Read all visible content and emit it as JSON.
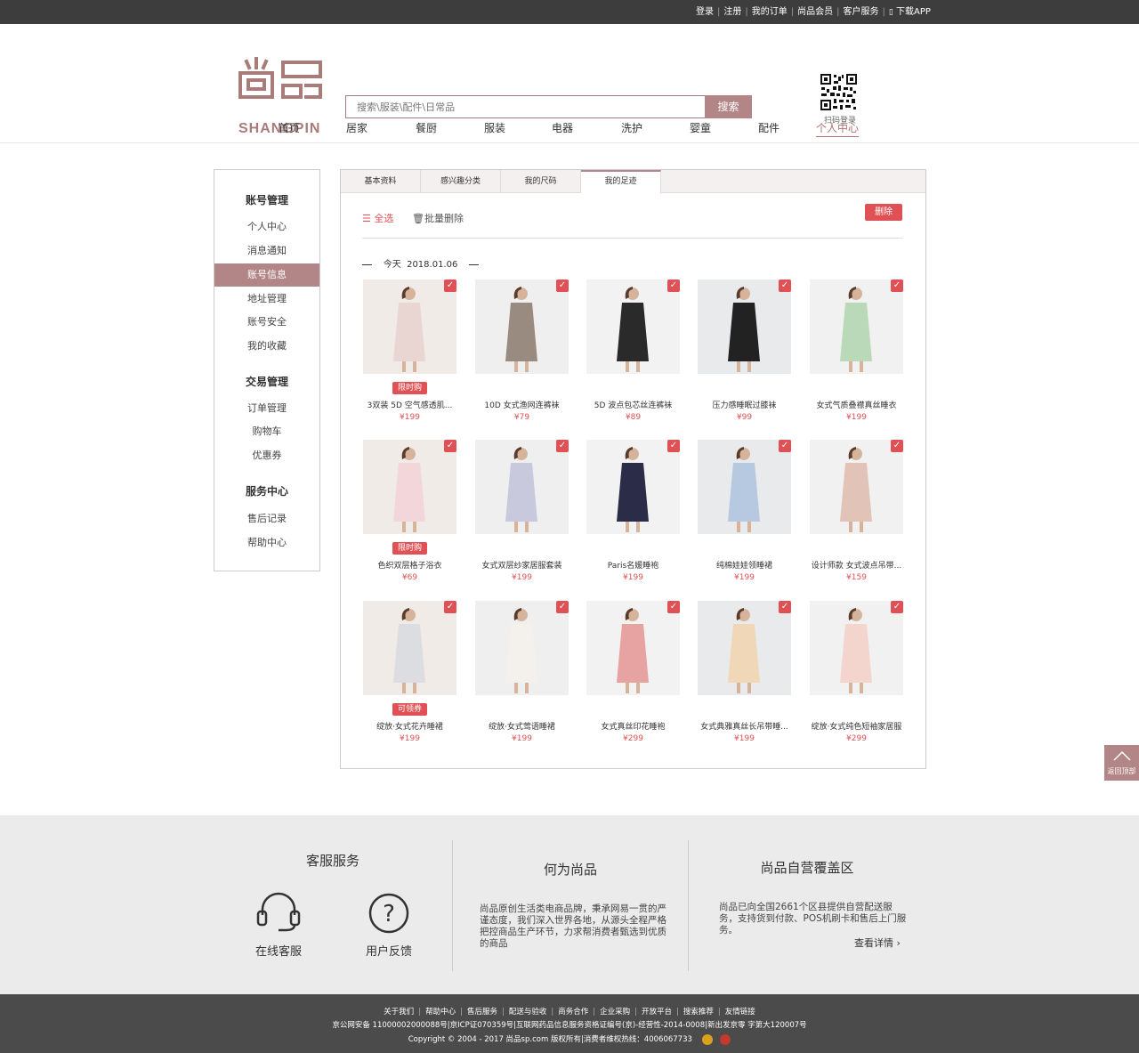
{
  "topbar": {
    "links": [
      "登录",
      "注册",
      "我的订单",
      "尚品会员",
      "客户服务",
      "下载APP"
    ]
  },
  "header": {
    "logo_text": "SHANGPIN",
    "search_placeholder": "搜索\\服装\\配件\\日常品",
    "search_button": "搜索",
    "qr_label": "扫码登录"
  },
  "nav": {
    "items": [
      "首页",
      "居家",
      "餐厨",
      "服装",
      "电器",
      "洗护",
      "婴童",
      "配件",
      "个人中心"
    ],
    "active_index": 8
  },
  "sidebar": {
    "groups": [
      {
        "title": "账号管理",
        "items": [
          "个人中心",
          "消息通知",
          "账号信息",
          "地址管理",
          "账号安全",
          "我的收藏"
        ]
      },
      {
        "title": "交易管理",
        "items": [
          "订单管理",
          "购物车",
          "优惠券"
        ]
      },
      {
        "title": "服务中心",
        "items": [
          "售后记录",
          "帮助中心"
        ]
      }
    ],
    "active_item": "账号信息"
  },
  "tabs": {
    "items": [
      "基本资料",
      "感兴趣分类",
      "我的尺码",
      "我的足迹"
    ],
    "active_index": 3
  },
  "toolbar": {
    "select_all": "全选",
    "batch_delete": "批量删除",
    "delete_button": "删除"
  },
  "date_header": {
    "label": "今天",
    "date": "2018.01.06"
  },
  "products": [
    {
      "name": "3双装 5D 空气感透肌...",
      "price": "¥199",
      "badge": "限时购"
    },
    {
      "name": "10D 女式渔网连裤袜",
      "price": "¥79",
      "badge": ""
    },
    {
      "name": "5D 波点包芯丝连裤袜",
      "price": "¥89",
      "badge": ""
    },
    {
      "name": "压力感睡眠过膝袜",
      "price": "¥99",
      "badge": ""
    },
    {
      "name": "女式气质叠襟真丝睡衣",
      "price": "¥199",
      "badge": ""
    },
    {
      "name": "色织双层格子浴衣",
      "price": "¥69",
      "badge": "限时购"
    },
    {
      "name": "女式双层纱家居服套装",
      "price": "¥199",
      "badge": ""
    },
    {
      "name": "Paris名媛睡袍",
      "price": "¥199",
      "badge": ""
    },
    {
      "name": "纯棉娃娃领睡裙",
      "price": "¥199",
      "badge": ""
    },
    {
      "name": "设计师款 女式波点吊带...",
      "price": "¥159",
      "badge": ""
    },
    {
      "name": "绽放·女式花卉睡裙",
      "price": "¥199",
      "badge": "可领券"
    },
    {
      "name": "绽放·女式莺语睡裙",
      "price": "¥199",
      "badge": ""
    },
    {
      "name": "女式真丝印花睡袍",
      "price": "¥299",
      "badge": ""
    },
    {
      "name": "女式典雅真丝长吊带睡...",
      "price": "¥199",
      "badge": ""
    },
    {
      "name": "绽放·女式纯色短袖家居服",
      "price": "¥299",
      "badge": ""
    }
  ],
  "back_to_top": "返回顶部",
  "footer": {
    "service": {
      "title": "客服服务",
      "items": [
        "在线客服",
        "用户反馈"
      ]
    },
    "about": {
      "title": "何为尚品",
      "text": "尚品原创生活类电商品牌，秉承网易一贯的严谨态度，我们深入世界各地，从源头全程严格把控商品生产环节，力求帮消费者甄选到优质的商品"
    },
    "coverage": {
      "title": "尚品自营覆盖区",
      "text": "尚品已向全国2661个区县提供自营配送服务，支持货到付款、POS机刷卡和售后上门服务。",
      "more": "查看详情"
    }
  },
  "bottom": {
    "links": [
      "关于我们",
      "帮助中心",
      "售后服务",
      "配送与验收",
      "商务合作",
      "企业采购",
      "开放平台",
      "搜索推荐",
      "友情链接"
    ],
    "license": "京公网安备 11000002000088号|京ICP证070359号|互联网药品信息服务资格证编号(京)-经营性-2014-0008|新出发京零 字第大120007号",
    "copyright": "Copyright © 2004 - 2017  尚品sp.com 版权所有|消费者维权热线：4006067733"
  }
}
